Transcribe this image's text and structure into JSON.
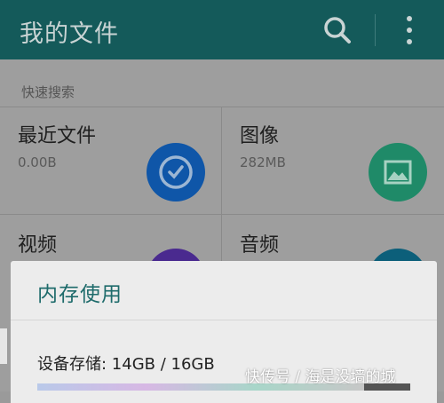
{
  "appbar": {
    "title": "我的文件",
    "icons": [
      "search-icon",
      "more-vertical-icon"
    ]
  },
  "quick_search": {
    "section_label": "快速搜索",
    "tiles": [
      {
        "label": "最近文件",
        "sub": "0.00B",
        "icon": "clock-icon",
        "color": "#0f56a8"
      },
      {
        "label": "图像",
        "sub": "282MB",
        "icon": "image-icon",
        "color": "#1f8a68"
      },
      {
        "label": "视频",
        "sub": "",
        "icon": "video-icon",
        "color": "#4a2a8f"
      },
      {
        "label": "音频",
        "sub": "",
        "icon": "audio-icon",
        "color": "#0c5f7a"
      }
    ]
  },
  "dialog": {
    "title": "内存使用",
    "storage_text": "设备存储: 14GB / 16GB",
    "usage_fraction": 0.875
  },
  "watermark": "快传号 / 海是没墙的城",
  "colors": {
    "appbar": "#145a5a",
    "dialog_title": "#1e6b6b",
    "scrim": "#9e9e9e"
  }
}
